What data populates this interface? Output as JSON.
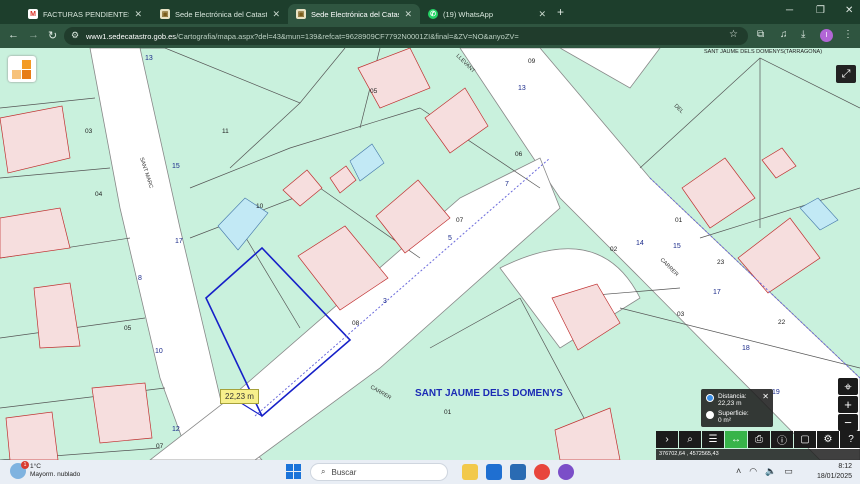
{
  "browser": {
    "tabs": [
      {
        "label": "FACTURAS PENDIENTES POR SUBIR",
        "icon": "gmail-icon",
        "active": false
      },
      {
        "label": "Sede Electrónica del Catastro",
        "icon": "catastro-icon",
        "active": false
      },
      {
        "label": "Sede Electrónica del Catastro",
        "icon": "catastro-icon",
        "active": true
      },
      {
        "label": "(19) WhatsApp",
        "icon": "whatsapp-icon",
        "active": false
      }
    ],
    "new_tab": "+",
    "address": {
      "host": "www1.sedecatastro.gob.es",
      "path": "/Cartografia/mapa.aspx?del=43&mun=139&refcat=9628909CF7792N0001ZI&final=&ZV=NO&anyoZV="
    },
    "profile_initial": "I"
  },
  "map": {
    "header": "SANT JAUME DELS DOMENYS(TARRAGONA)",
    "place_label": "SANT JAUME DELS DOMENYS",
    "streets": [
      "SANT MARC",
      "LLEVANT",
      "CARRER",
      "CARRER",
      "DEL"
    ],
    "parcel_labels": [
      "11",
      "05",
      "09",
      "03",
      "04",
      "10",
      "07",
      "06",
      "08",
      "05",
      "01",
      "02",
      "03",
      "23",
      "22",
      "01",
      "07",
      "12"
    ],
    "road_numbers": [
      "13",
      "15",
      "17",
      "8",
      "10",
      "12",
      "3",
      "5",
      "7",
      "13",
      "14",
      "15",
      "17",
      "18",
      "19"
    ],
    "distance_label": "22,23 m",
    "measure": {
      "distance_label": "Distancia:",
      "distance_value": "22,23 m",
      "surface_label": "Superficie:",
      "surface_value": "0 m²",
      "selected": "distance"
    },
    "coords": "376702,64 , 4572565,43",
    "colors": {
      "parcel": "#c9f1dd",
      "road": "#ffffff",
      "building": "#f6dede",
      "parcel_line": "#444444",
      "measure_line": "#1620c8"
    }
  },
  "taskbar": {
    "weather_temp": "1°C",
    "weather_desc": "Mayorm. nublado",
    "weather_badge": "1",
    "search_placeholder": "Buscar",
    "time": "8:12",
    "date": "18/01/2025"
  }
}
